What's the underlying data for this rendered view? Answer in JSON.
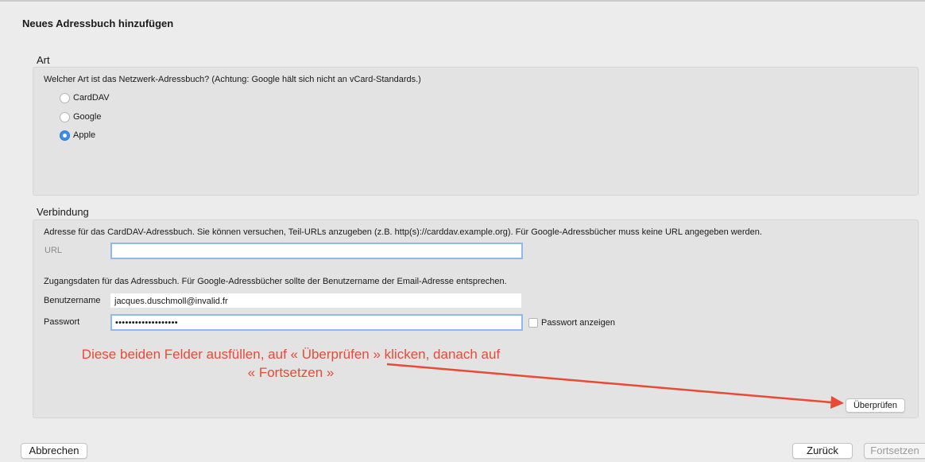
{
  "window": {
    "title": "Neues Adressbuch hinzufügen"
  },
  "art": {
    "label": "Art",
    "description": "Welcher Art ist das Netzwerk-Adressbuch? (Achtung: Google hält sich nicht an vCard-Standards.)",
    "options": [
      {
        "label": "CardDAV",
        "selected": false
      },
      {
        "label": "Google",
        "selected": false
      },
      {
        "label": "Apple",
        "selected": true
      }
    ]
  },
  "verbindung": {
    "label": "Verbindung",
    "url_description": "Adresse für das CardDAV-Adressbuch. Sie können versuchen, Teil-URLs anzugeben (z.B. http(s)://carddav.example.org). Für Google-Adressbücher muss keine URL angegeben werden.",
    "url_label": "URL",
    "url_value": "",
    "credentials_description": "Zugangsdaten für das Adressbuch. Für Google-Adressbücher sollte der Benutzername der Email-Adresse entsprechen.",
    "username_label": "Benutzername",
    "username_value": "jacques.duschmoll@invalid.fr",
    "password_label": "Passwort",
    "password_value": "•••••••••••••••••••",
    "show_password_label": "Passwort anzeigen",
    "show_password_checked": false,
    "verify_button": "Überprüfen"
  },
  "annotation": {
    "line1": "Diese beiden Felder ausfüllen, auf « Überprüfen » klicken, danach auf",
    "line2": "« Fortsetzen »",
    "color": "#e94a35"
  },
  "footer": {
    "cancel_button": "Abbrechen",
    "back_button": "Zurück",
    "continue_button": "Fortsetzen"
  }
}
